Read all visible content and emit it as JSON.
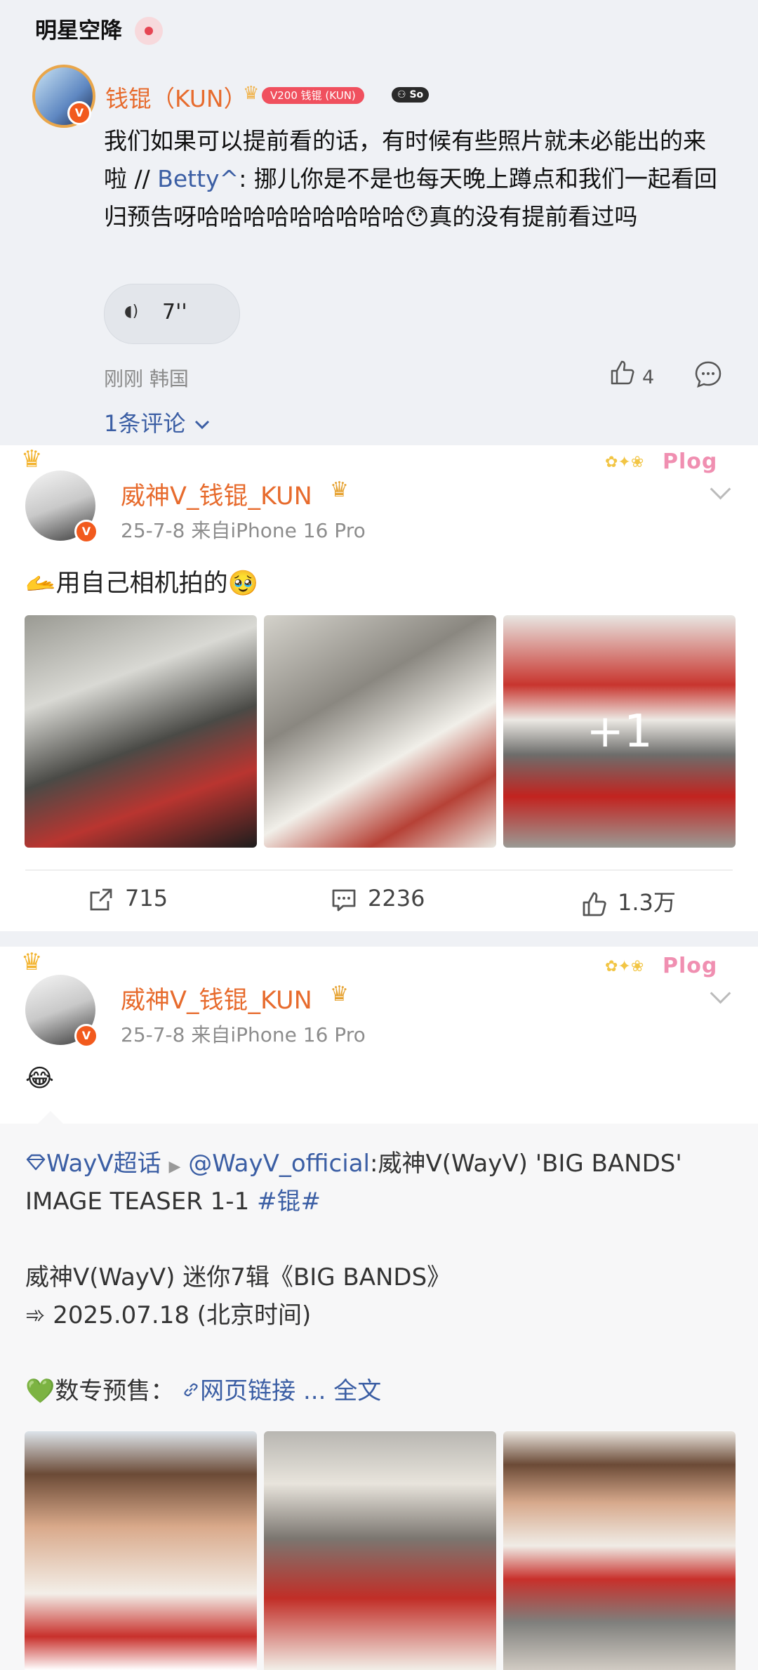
{
  "section": {
    "title": "明星空降"
  },
  "comment": {
    "user_name": "钱锟（KUN）",
    "level_badge": "V200 钱锟 (KUN)",
    "sign_badge": "So",
    "text_before": "我们如果可以提前看的话，有时候有些照片就未必能出的来啦 // ",
    "mention": "Betty^",
    "text_after": ": 挪儿你是不是也每天晚上蹲点和我们一起看回归预告呀哈哈哈哈哈哈哈哈哈😯真的没有提前看过吗",
    "voice_duration": "7''",
    "time_location": "刚刚 韩国",
    "likes": "4",
    "replies_link": "1条评论"
  },
  "posts": [
    {
      "user_name": "威神V_钱锟_KUN",
      "date_device": "25-7-8  来自iPhone 16 Pro",
      "plog_label": "Plog",
      "text": "🫴用自己相机拍的🥹",
      "more_images": "+1",
      "reposts": "715",
      "comments": "2236",
      "likes": "1.3万"
    },
    {
      "user_name": "威神V_钱锟_KUN",
      "date_device": "25-7-8  来自iPhone 16 Pro",
      "plog_label": "Plog",
      "text": "😂"
    }
  ],
  "repost": {
    "topic": "WayV超话",
    "author": "@WayV_official",
    "line1_rest": ":威神V(WayV) 'BIG BANDS'",
    "line2": "IMAGE TEASER 1-1 ",
    "hashtag": "#锟#",
    "line3": "威神V(WayV) 迷你7辑《BIG BANDS》",
    "line4": "➾ 2025.07.18 (北京时间)",
    "presale_label": "💚数专预售：",
    "web_link": "网页链接",
    "ellipsis": " ... ",
    "full_text": "全文"
  },
  "colors": {
    "name_orange": "#e76b2d",
    "link_blue": "#3b5ea4",
    "feed_gray": "#eff1f5"
  }
}
